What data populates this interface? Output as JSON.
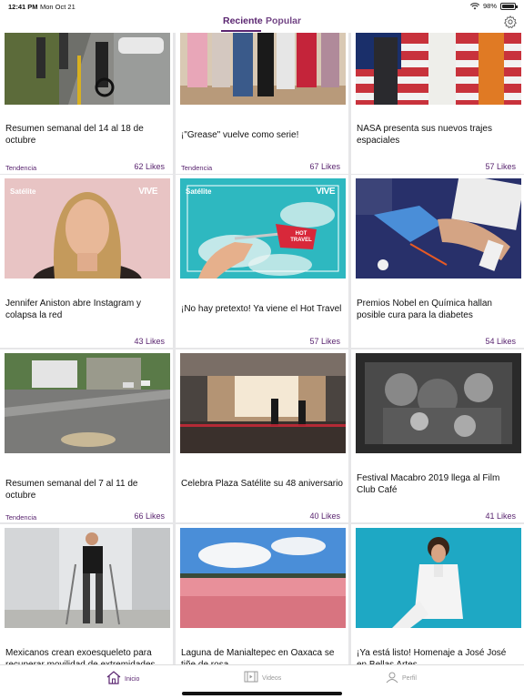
{
  "status": {
    "time": "12:41 PM",
    "date": "Mon Oct 21",
    "battery": "98%"
  },
  "header": {
    "tabs": [
      {
        "label": "Reciente",
        "active": true
      },
      {
        "label": "Popular",
        "active": false
      }
    ],
    "settings_icon": "gear-icon",
    "accent": "#5a2570"
  },
  "articles": [
    {
      "title": "Resumen semanal del 14 al 18 de octubre",
      "tag": "Tendencia",
      "likes": "62 Likes"
    },
    {
      "title": "¡\"Grease\" vuelve como serie!",
      "tag": "Tendencia",
      "likes": "67 Likes"
    },
    {
      "title": "NASA presenta sus nuevos trajes espaciales",
      "tag": "",
      "likes": "57 Likes"
    },
    {
      "title": "Jennifer Aniston abre Instagram y colapsa la red",
      "tag": "",
      "likes": "43 Likes",
      "overlay_left": "Satélite",
      "overlay_right": "VIVE"
    },
    {
      "title": "¡No hay pretexto! Ya viene el Hot Travel",
      "tag": "",
      "likes": "57 Likes",
      "overlay_left": "Satélite",
      "overlay_right": "VIVE",
      "overlay_sign": "HOT TRAVEL"
    },
    {
      "title": "Premios Nobel en Química hallan posible cura para la diabetes",
      "tag": "",
      "likes": "54 Likes"
    },
    {
      "title": "Resumen semanal del 7 al 11 de octubre",
      "tag": "Tendencia",
      "likes": "66 Likes"
    },
    {
      "title": "Celebra Plaza Satélite su 48 aniversario",
      "tag": "",
      "likes": "40 Likes"
    },
    {
      "title": "Festival Macabro 2019 llega al Film Club Café",
      "tag": "",
      "likes": "41 Likes"
    },
    {
      "title": "Mexicanos crean exoesqueleto para recuperar movilidad de extremidades",
      "tag": "",
      "likes": ""
    },
    {
      "title": "Laguna de Manialtepec en Oaxaca se tiñe de rosa",
      "tag": "",
      "likes": ""
    },
    {
      "title": "¡Ya está listo! Homenaje a José José en Bellas Artes",
      "tag": "",
      "likes": ""
    }
  ],
  "bottom_nav": [
    {
      "label": "Inicio",
      "icon": "home-icon",
      "active": true
    },
    {
      "label": "Videos",
      "icon": "video-icon",
      "active": false
    },
    {
      "label": "Perfil",
      "icon": "profile-icon",
      "active": false
    }
  ]
}
